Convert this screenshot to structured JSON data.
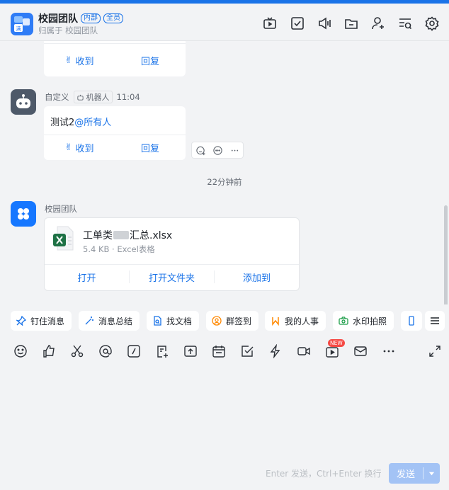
{
  "header": {
    "group_name": "校园团队",
    "badge_internal": "内部",
    "badge_all": "全员",
    "subtitle": "归属于 校园团队"
  },
  "colors": {
    "accent": "#1a73e8",
    "bot_avatar": "#4e5969",
    "app_avatar": "#1677ff",
    "excel": "#1e7145"
  },
  "messages": {
    "first_partial": {
      "received_label": "收到",
      "reply_label": "回复"
    },
    "second": {
      "sender": "自定义",
      "tag": "机器人",
      "time": "11:04",
      "text": "测试2",
      "mention": "@所有人",
      "received_label": "收到",
      "reply_label": "回复"
    },
    "divider": "22分钟前",
    "third": {
      "sender": "校园团队",
      "file_name_prefix": "工单类",
      "file_name_suffix": "汇总.xlsx",
      "file_meta": "5.4 KB · Excel表格",
      "actions": [
        "打开",
        "打开文件夹",
        "添加到"
      ]
    }
  },
  "quickbar": {
    "items": [
      "钉住消息",
      "消息总结",
      "找文档",
      "群签到",
      "我的人事",
      "水印拍照"
    ]
  },
  "toolbar": {
    "new_badge": "NEW"
  },
  "composer": {
    "hint": "Enter 发送，Ctrl+Enter 换行",
    "send_label": "发送"
  }
}
